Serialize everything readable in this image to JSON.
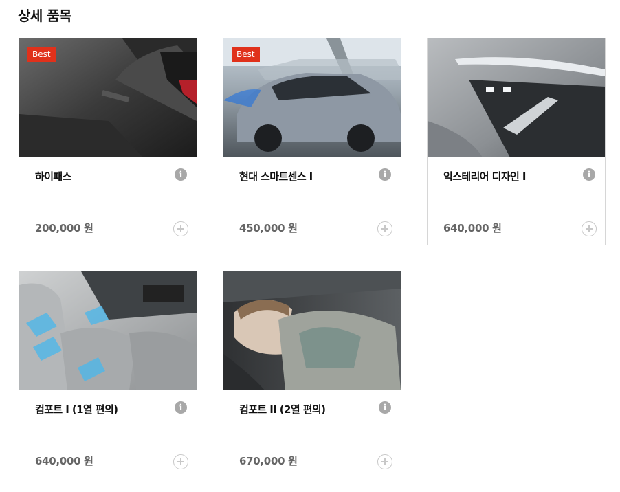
{
  "section": {
    "title": "상세 품목"
  },
  "items": [
    {
      "name": "하이패스",
      "price": "200,000 원",
      "badge": "Best",
      "image": "hi-pass-console-photo"
    },
    {
      "name": "현대 스마트센스 I",
      "price": "450,000 원",
      "badge": "Best",
      "image": "sedan-driving-photo"
    },
    {
      "name": "익스테리어 디자인 I",
      "price": "640,000 원",
      "image": "front-headlamp-photo"
    },
    {
      "name": "컴포트 I (1열 편의)",
      "price": "640,000 원",
      "image": "front-seat-ventilation-photo"
    },
    {
      "name": "컴포트 II (2열 편의)",
      "price": "670,000 원",
      "image": "baby-in-rear-seat-photo"
    }
  ],
  "icons": {
    "info": "info-icon",
    "add": "add-circle-icon"
  },
  "colors": {
    "badge": "#e0311b",
    "border": "#d6d6d6",
    "price": "#666666",
    "icon": "#a8a8a8"
  }
}
